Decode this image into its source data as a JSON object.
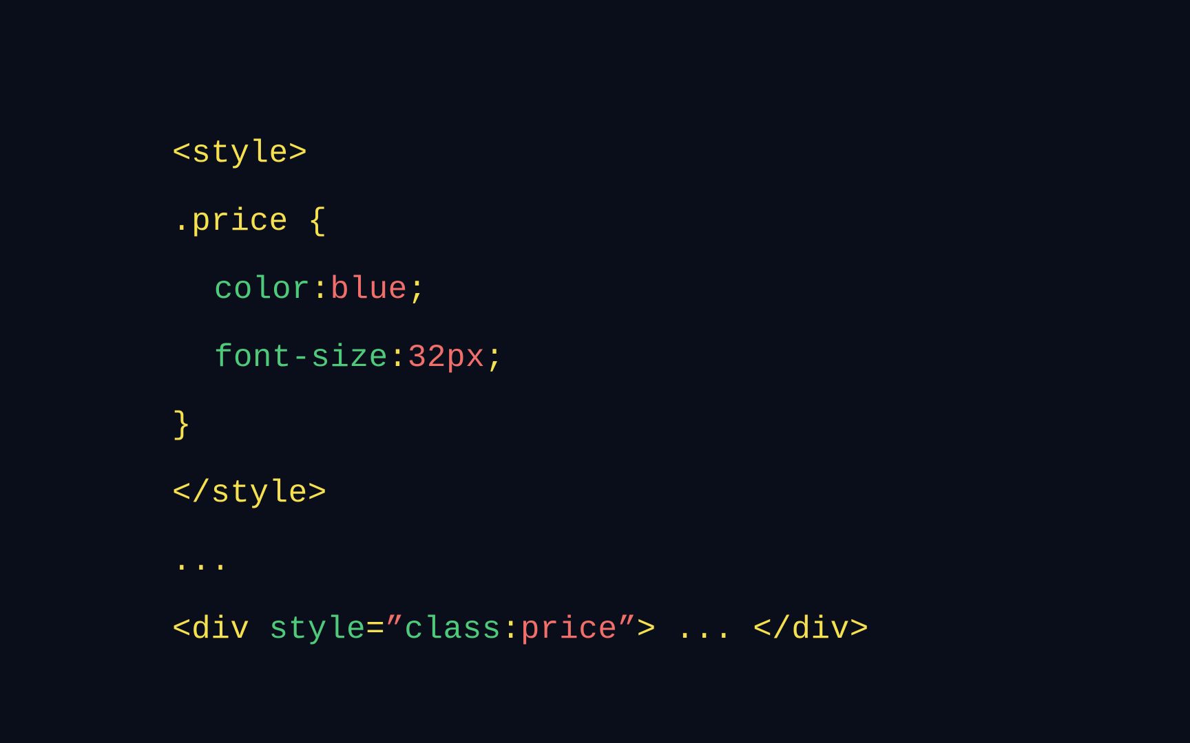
{
  "code": {
    "styleOpen": "<style>",
    "selector": ".price",
    "braceOpen": " {",
    "prop1Name": "color",
    "colon": ":",
    "prop1Value": "blue",
    "semicolon": ";",
    "prop2Name": "font-size",
    "prop2Value": "32px",
    "braceClose": "}",
    "styleClose": "</style>",
    "ellipsis": "...",
    "divOpen1": "<div ",
    "attrName": "style",
    "attrEq": "=",
    "attrQuoteOpen": "”",
    "attrNameInner": "class",
    "attrValInner": "price",
    "attrQuoteClose": "”",
    "divOpen2": ">",
    "divContent": " ... ",
    "divClose": "</div>"
  },
  "colors": {
    "background": "#0a0d1a",
    "tag": "#f5e050",
    "property": "#4fc97a",
    "value": "#f06f6a",
    "highlightBg": "rgba(245,224,80,0.18)",
    "highlightBorder": "#f5e050"
  }
}
